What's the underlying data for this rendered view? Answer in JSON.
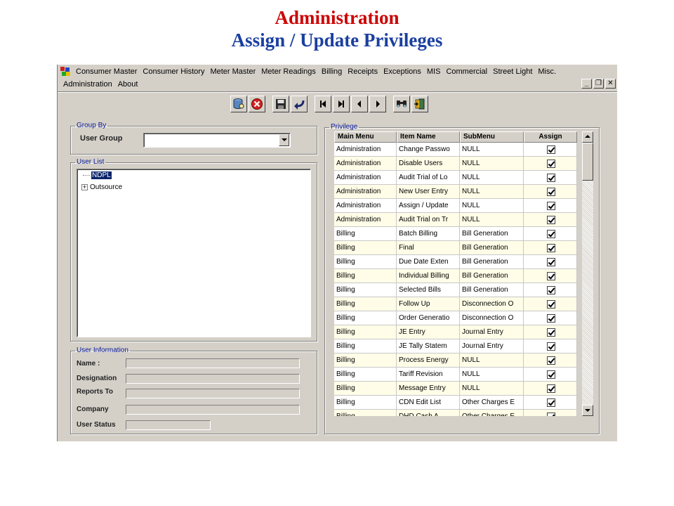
{
  "slide": {
    "title": "Administration",
    "subtitle": "Assign / Update Privileges"
  },
  "menubar": {
    "row1": [
      "Consumer Master",
      "Consumer History",
      "Meter Master",
      "Meter Readings",
      "Billing",
      "Receipts",
      "Exceptions",
      "MIS",
      "Commercial",
      "Street Light",
      "Misc."
    ],
    "row2": [
      "Administration",
      "About"
    ]
  },
  "window_controls": {
    "minimize": "_",
    "restore": "❐",
    "close": "✕"
  },
  "toolbar": [
    "find-database-icon",
    "cancel-icon",
    "save-icon",
    "undo-icon",
    "first-record-icon",
    "last-record-icon",
    "previous-record-icon",
    "next-record-icon",
    "search-icon",
    "exit-icon"
  ],
  "group_by": {
    "legend": "Group By",
    "user_group_label": "User Group",
    "user_group_value": ""
  },
  "user_list": {
    "legend": "User List",
    "nodes": [
      "NDPL",
      "Outsource"
    ]
  },
  "user_info": {
    "legend": "User Information",
    "name_label": "Name :",
    "designation_label": "Designation",
    "reports_to_label": "Reports To",
    "company_label": "Company",
    "status_label": "User Status"
  },
  "privilege": {
    "legend": "Privilege",
    "columns": [
      "Main Menu",
      "Item Name",
      "SubMenu",
      "Assign"
    ],
    "rows": [
      [
        "Administration",
        "Change Passwo",
        "NULL",
        true
      ],
      [
        "Administration",
        "Disable Users",
        "NULL",
        true
      ],
      [
        "Administration",
        "Audit Trial of Lo",
        "NULL",
        true
      ],
      [
        "Administration",
        "New User Entry",
        "NULL",
        true
      ],
      [
        "Administration",
        "Assign / Update",
        "NULL",
        true
      ],
      [
        "Administration",
        "Audit Trial on Tr",
        "NULL",
        true
      ],
      [
        "Billing",
        "Batch Billing",
        "Bill Generation",
        true
      ],
      [
        "Billing",
        "Final",
        "Bill Generation",
        true
      ],
      [
        "Billing",
        "Due Date Exten",
        "Bill Generation",
        true
      ],
      [
        "Billing",
        "Individual Billing",
        "Bill Generation",
        true
      ],
      [
        "Billing",
        "Selected Bills",
        "Bill Generation",
        true
      ],
      [
        "Billing",
        "Follow Up",
        "Disconnection O",
        true
      ],
      [
        "Billing",
        "Order Generatio",
        "Disconnection O",
        true
      ],
      [
        "Billing",
        "JE Entry",
        "Journal Entry",
        true
      ],
      [
        "Billing",
        "JE Tally Statem",
        "Journal Entry",
        true
      ],
      [
        "Billing",
        "Process Energy",
        "NULL",
        true
      ],
      [
        "Billing",
        "Tariff Revision",
        "NULL",
        true
      ],
      [
        "Billing",
        "Message Entry",
        "NULL",
        true
      ],
      [
        "Billing",
        "CDN Edit List",
        "Other Charges E",
        true
      ],
      [
        "Billing",
        "DHD Cash A",
        "Other Charges E",
        true
      ]
    ]
  }
}
